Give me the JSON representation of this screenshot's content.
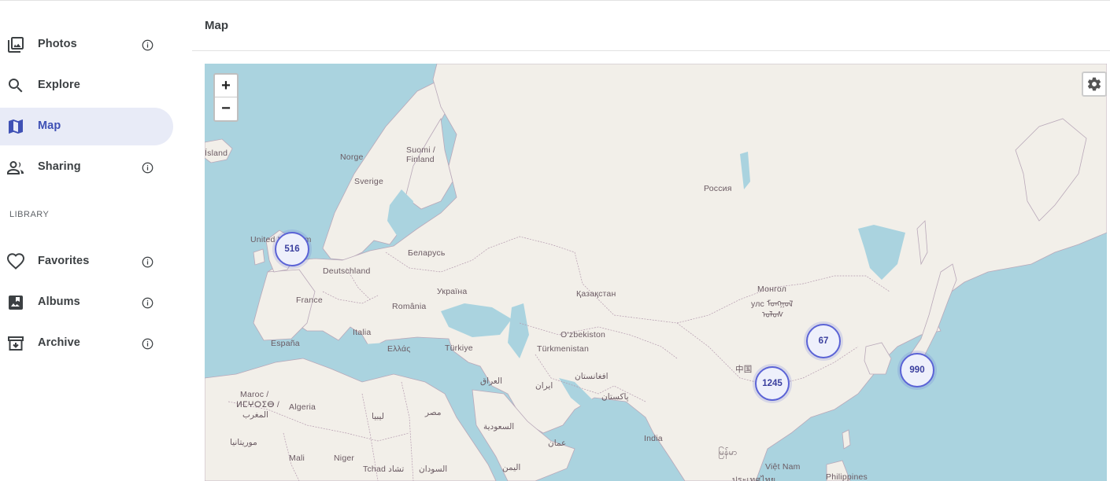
{
  "sidebar": {
    "items": [
      {
        "label": "Photos",
        "icon": "photos-icon",
        "has_info": true
      },
      {
        "label": "Explore",
        "icon": "search-icon",
        "has_info": false
      },
      {
        "label": "Map",
        "icon": "map-icon",
        "has_info": false,
        "active": true
      },
      {
        "label": "Sharing",
        "icon": "people-icon",
        "has_info": true
      }
    ],
    "library_title": "LIBRARY",
    "library_items": [
      {
        "label": "Favorites",
        "icon": "heart-icon",
        "has_info": true
      },
      {
        "label": "Albums",
        "icon": "albums-icon",
        "has_info": true
      },
      {
        "label": "Archive",
        "icon": "archive-icon",
        "has_info": true
      }
    ]
  },
  "header": {
    "title": "Map"
  },
  "map": {
    "zoom_in": "+",
    "zoom_out": "−",
    "settings_icon": "gear-icon",
    "clusters": [
      "516",
      "67",
      "1245",
      "990"
    ],
    "labels": {
      "island": "Ísland",
      "norge": "Norge",
      "suomi": "Suomi /",
      "finland": "Finland",
      "sverige": "Sverige",
      "uk": "United Kingdom",
      "russia": "Россия",
      "belarus": "Беларусь",
      "deutschland": "Deutschland",
      "ukraine": "Україна",
      "france": "France",
      "romania": "România",
      "kazakhstan": "Қазақстан",
      "mongolia1": "Монгол",
      "mongolia2": "улс ᠮᠣᠩᠭᠣᠯ",
      "mongolia3": "ᠤᠯᠤᠰ",
      "espana": "España",
      "italia": "Italia",
      "ellas": "Ελλάς",
      "turkiye": "Türkiye",
      "uzbekistan": "O‘zbekiston",
      "turkmenistan": "Türkmenistan",
      "china": "中国",
      "maroc1": "Maroc /",
      "maroc2": "ⵍⵎⵖⵔⵉⴱ /",
      "maroc3": "المغرب",
      "algeria": "Algeria",
      "iraq": "العراق",
      "iran": "ایران",
      "afghanistan": "افغانستان",
      "pakistan": "پاکستان",
      "libya": "ليبيا",
      "egypt": "مصر",
      "saudi": "السعودية",
      "india": "India",
      "mauritania": "موريتانيا",
      "mali": "Mali",
      "niger": "Niger",
      "tchad": "Tchad تشاد",
      "sudan": "السودان",
      "yemen": "اليمن",
      "oman": "عمان",
      "myanmar": "မြန်မာ",
      "vietnam": "Việt Nam",
      "thailand": "ประเทศไทย",
      "philippines": "Philippines"
    }
  },
  "colors": {
    "accent": "#3f51b5",
    "active_bg": "#e8ebf7",
    "water": "#aad3df",
    "land": "#f2efe9",
    "cluster_border": "#5b63d6"
  }
}
